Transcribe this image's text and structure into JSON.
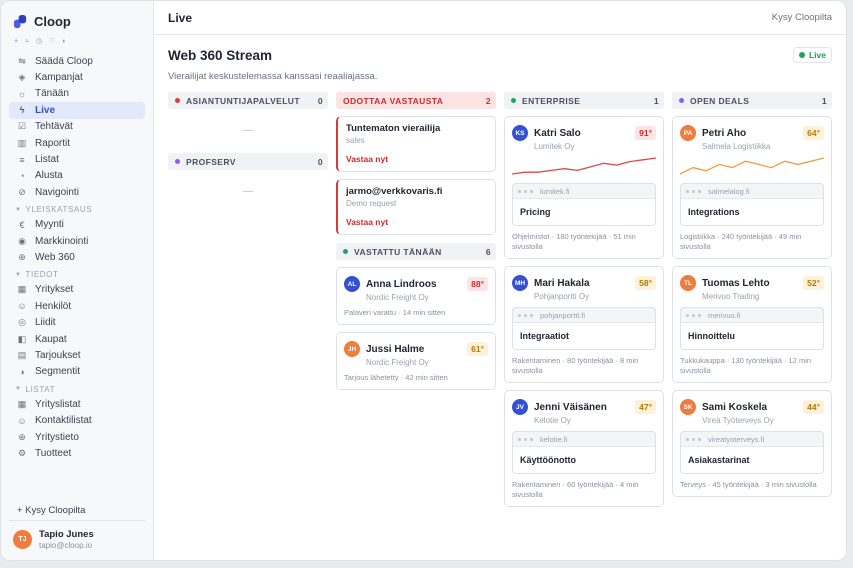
{
  "brand": {
    "name": "Cloop"
  },
  "sidebar": {
    "mini_icons": [
      "+",
      "≈",
      "◷",
      "♡",
      "◐"
    ],
    "items": [
      {
        "label": "Säädä Cloop",
        "icon": "⇋",
        "name": "sliders-icon"
      },
      {
        "label": "Kampanjat",
        "icon": "◈",
        "name": "campaign-icon"
      },
      {
        "label": "Tänään",
        "icon": "☼",
        "name": "sun-icon"
      },
      {
        "label": "Live",
        "icon": "ϟ",
        "name": "bolt-icon",
        "active": true
      },
      {
        "label": "Tehtävät",
        "icon": "☑",
        "name": "checkbox-icon"
      },
      {
        "label": "Raportit",
        "icon": "▥",
        "name": "bar-chart-icon"
      },
      {
        "label": "Listat",
        "icon": "≡",
        "name": "list-icon"
      },
      {
        "label": "Alusta",
        "icon": "◔",
        "name": "clock-icon"
      },
      {
        "label": "Navigointi",
        "icon": "⊘",
        "name": "compass-icon"
      }
    ],
    "sections": [
      {
        "title": "YLEISKATSAUS",
        "items": [
          {
            "label": "Myynti",
            "icon": "€",
            "name": "euro-icon"
          },
          {
            "label": "Markkinointi",
            "icon": "◉",
            "name": "target-icon"
          },
          {
            "label": "Web 360",
            "icon": "⊕",
            "name": "globe-icon"
          }
        ]
      },
      {
        "title": "TIEDOT",
        "items": [
          {
            "label": "Yritykset",
            "icon": "▦",
            "name": "building-icon"
          },
          {
            "label": "Henkilöt",
            "icon": "☺",
            "name": "person-icon"
          },
          {
            "label": "Liidit",
            "icon": "◎",
            "name": "lead-icon"
          },
          {
            "label": "Kaupat",
            "icon": "◧",
            "name": "deal-icon"
          },
          {
            "label": "Tarjoukset",
            "icon": "▤",
            "name": "document-icon"
          },
          {
            "label": "Segmentit",
            "icon": "◑",
            "name": "pie-icon"
          }
        ]
      },
      {
        "title": "LISTAT",
        "items": [
          {
            "label": "Yrityslistat",
            "icon": "▦",
            "name": "building-list-icon"
          },
          {
            "label": "Kontaktilistat",
            "icon": "☺",
            "name": "contact-list-icon"
          },
          {
            "label": "Yritystieto",
            "icon": "⊕",
            "name": "company-info-icon"
          },
          {
            "label": "Tuotteet",
            "icon": "⚙",
            "name": "product-icon"
          }
        ]
      }
    ],
    "ask": "+ Kysy Cloopilta",
    "user": {
      "initials": "TJ",
      "name": "Tapio Junes",
      "email": "tapio@cloop.io"
    }
  },
  "topbar": {
    "title": "Live",
    "ask": "Kysy Cloopilta"
  },
  "page": {
    "title": "Web 360 Stream",
    "subtitle": "Vierailijat keskustelemassa kanssasi reaaliajassa.",
    "live_badge": "Live"
  },
  "columns": {
    "asiantuntija": {
      "label": "ASIANTUNTIJAPALVELUT",
      "count": "0",
      "dot": "#e23b3b",
      "empty": "—"
    },
    "profserv": {
      "label": "PROFSERV",
      "count": "0",
      "dot": "#8b5cf6",
      "empty": "—"
    },
    "odottaa": {
      "label": "ODOTTAA VASTAUSTA",
      "count": "2",
      "cards": [
        {
          "title": "Tuntematon vierailija",
          "sub": "sales",
          "action": "Vastaa nyt"
        },
        {
          "title": "jarmo@verkkovaris.fi",
          "sub": "Demo request",
          "action": "Vastaa nyt"
        }
      ]
    },
    "vastattu": {
      "label": "VASTATTU TÄNÄÄN",
      "count": "6",
      "dot": "#22a35a",
      "cards": [
        {
          "initials": "AL",
          "avatar": "#3451d1",
          "name": "Anna Lindroos",
          "score": "88°",
          "level": "hot",
          "company": "Nordic Freight Oy",
          "meta": "Palaveri varattu · 14 min sitten"
        },
        {
          "initials": "JH",
          "avatar": "#ef7b3d",
          "name": "Jussi Halme",
          "score": "61°",
          "level": "warm",
          "company": "Nordic Freight Oy",
          "meta": "Tarjous lähetetty · 42 min sitten"
        }
      ]
    },
    "enterprise": {
      "label": "ENTERPRISE",
      "count": "1",
      "dot": "#22a35a",
      "cards": [
        {
          "initials": "KS",
          "avatar": "#3451d1",
          "name": "Katri Salo",
          "score": "91°",
          "level": "hot",
          "company": "Lumitek Oy",
          "url": "lumitek.fi",
          "page": "Pricing",
          "meta": "Ohjelmistot · 180 työntekijää · 51 min sivustolla",
          "spark": [
            12,
            11,
            11,
            10,
            9,
            10,
            8,
            6,
            7,
            5,
            4,
            3
          ],
          "spark_color": "#e0474c"
        },
        {
          "initials": "MH",
          "avatar": "#3451d1",
          "name": "Mari Hakala",
          "score": "58°",
          "level": "warm",
          "company": "Pohjanportti Oy",
          "url": "pohjanportti.fi",
          "page": "Integraatiot",
          "meta": "Rakentaminen · 80 työntekijää · 8 min sivustolla"
        },
        {
          "initials": "JV",
          "avatar": "#3451d1",
          "name": "Jenni Väisänen",
          "score": "47°",
          "level": "warm",
          "company": "Kelotie Oy",
          "url": "kelotie.fi",
          "page": "Käyttöönotto",
          "meta": "Rakentaminen · 60 työntekijää · 4 min sivustolla"
        }
      ]
    },
    "open_deals": {
      "label": "OPEN DEALS",
      "count": "1",
      "dot": "#8b5cf6",
      "cards": [
        {
          "initials": "PA",
          "avatar": "#ef7b3d",
          "name": "Petri Aho",
          "score": "64°",
          "level": "warm",
          "company": "Salmela Logistiikka",
          "url": "salmelalog.fi",
          "page": "Integrations",
          "meta": "Logistiikka · 240 työntekijää · 49 min sivustolla",
          "spark": [
            9,
            7,
            8,
            6,
            7,
            5,
            6,
            7,
            5,
            6,
            5,
            4
          ],
          "spark_color": "#e8a13b"
        },
        {
          "initials": "TL",
          "avatar": "#ef7b3d",
          "name": "Tuomas Lehto",
          "score": "52°",
          "level": "warm",
          "company": "Merivuo Trading",
          "url": "merivuo.fi",
          "page": "Hinnoittelu",
          "meta": "Tukkukauppa · 130 työntekijää · 12 min sivustolla"
        },
        {
          "initials": "SK",
          "avatar": "#ef7b3d",
          "name": "Sami Koskela",
          "score": "44°",
          "level": "warm",
          "company": "Vireä Työterveys Oy",
          "url": "vireatyoterveys.fi",
          "page": "Asiakastarinat",
          "meta": "Terveys · 45 työntekijää · 3 min sivustolla"
        }
      ]
    }
  }
}
